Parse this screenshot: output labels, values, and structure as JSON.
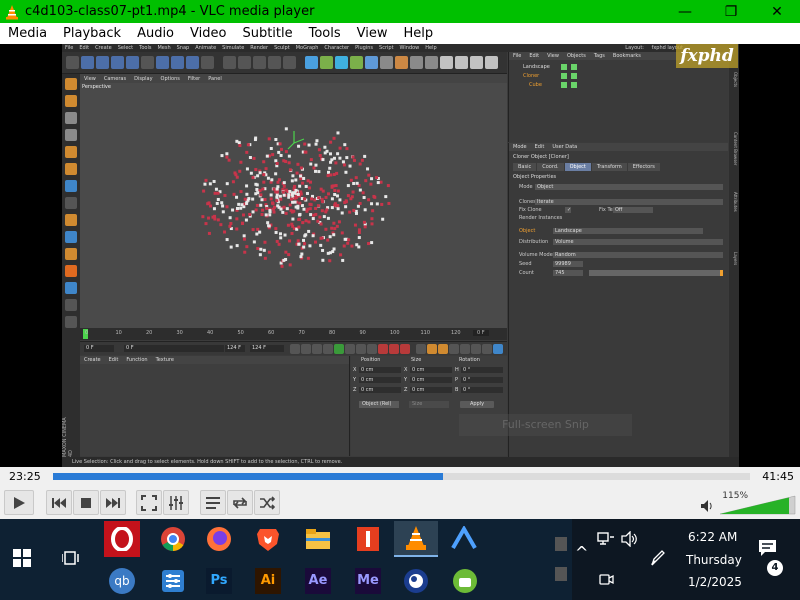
{
  "window": {
    "title": "c4d103-class07-pt1.mp4 - VLC media player",
    "minimize": "—",
    "maximize": "❐",
    "close": "✕"
  },
  "menu": [
    "Media",
    "Playback",
    "Audio",
    "Video",
    "Subtitle",
    "Tools",
    "View",
    "Help"
  ],
  "c4d": {
    "menu": [
      "File",
      "Edit",
      "Create",
      "Select",
      "Tools",
      "Mesh",
      "Snap",
      "Animate",
      "Simulate",
      "Render",
      "Sculpt",
      "MoGraph",
      "Character",
      "Plugins",
      "Script",
      "Window",
      "Help"
    ],
    "layout_label": "Layout:",
    "layout_value": "fxphd layout",
    "viewport_menu": [
      "View",
      "Cameras",
      "Display",
      "Options",
      "Filter",
      "Panel"
    ],
    "viewport_name": "Perspective",
    "timeline_ticks": [
      "0",
      "10",
      "20",
      "30",
      "40",
      "50",
      "60",
      "70",
      "80",
      "90",
      "100",
      "110",
      "120"
    ],
    "frame_readout": "0 F",
    "transport": {
      "start": "0 F",
      "current": "0 F",
      "end": "124 F",
      "end2": "124 F"
    },
    "materials_menu": [
      "Create",
      "Edit",
      "Function",
      "Texture"
    ],
    "coords_headers": [
      "Position",
      "Size",
      "Rotation"
    ],
    "coords": [
      {
        "axis": "X",
        "pos": "0 cm",
        "size_axis": "X",
        "size": "0 cm",
        "rot_axis": "H",
        "rot": "0 °"
      },
      {
        "axis": "Y",
        "pos": "0 cm",
        "size_axis": "Y",
        "size": "0 cm",
        "rot_axis": "P",
        "rot": "0 °"
      },
      {
        "axis": "Z",
        "pos": "0 cm",
        "size_axis": "Z",
        "size": "0 cm",
        "rot_axis": "B",
        "rot": "0 °"
      }
    ],
    "object_rel": "Object (Rel)",
    "size_mode": "Size",
    "apply": "Apply",
    "maxon": "MAXON CINEMA 4D",
    "status": "Live Selection: Click and drag to select elements. Hold down SHIFT to add to the selection, CTRL to remove.",
    "om_menu": [
      "File",
      "Edit",
      "View",
      "Objects",
      "Tags",
      "Bookmarks"
    ],
    "om_objects": [
      {
        "name": "Landscape",
        "color": "#dddddd"
      },
      {
        "name": "Cloner",
        "color": "#f0a030"
      },
      {
        "name": "Cube",
        "color": "#f0a030"
      }
    ],
    "attr_menu": [
      "Mode",
      "Edit",
      "User Data"
    ],
    "attr_title": "Cloner Object [Cloner]",
    "attr_tabs": [
      "Basic",
      "Coord.",
      "Object",
      "Transform",
      "Effectors"
    ],
    "attr_active_tab": "Object",
    "attr_section": "Object Properties",
    "attrs": [
      {
        "label": "Mode",
        "value": "Object"
      },
      {
        "label": "Clones",
        "value": "Iterate"
      },
      {
        "label": "Fix Clone",
        "value": "✓"
      },
      {
        "label": "Fix Texture",
        "value": "Off"
      },
      {
        "label": "Render Instances",
        "value": ""
      },
      {
        "label": "Object",
        "value": "Landscape"
      },
      {
        "label": "Distribution",
        "value": "Volume"
      },
      {
        "label": "Volume Mode",
        "value": "Random"
      },
      {
        "label": "Seed",
        "value": "99989"
      },
      {
        "label": "Count",
        "value": "745"
      }
    ],
    "side_tabs": [
      "Objects",
      "Content Browser",
      "Attributes",
      "Layers"
    ],
    "logo": "fxphd"
  },
  "snip_overlay": "Full-screen Snip",
  "playback": {
    "current_time": "23:25",
    "total_time": "41:45",
    "progress": 0.56,
    "volume_pct": "115%",
    "volume": 1.15
  },
  "taskbar": {
    "time": "6:22 AM",
    "day": "Thursday",
    "date": "1/2/2025",
    "notifications": "4",
    "apps_top": [
      "opera-icon",
      "chrome-icon",
      "firefox-icon",
      "brave-icon",
      "file-explorer-icon",
      "pdf-icon",
      "vlc-icon",
      "vpn-icon"
    ],
    "apps_bottom": [
      "qbittorrent-icon",
      "settings-icon",
      "photoshop-icon",
      "illustrator-icon",
      "after-effects-icon",
      "media-encoder-icon",
      "cinema4d-icon",
      "android-icon"
    ],
    "labels_bottom": {
      "qb": "qb",
      "ps": "Ps",
      "ai": "Ai",
      "ae": "Ae",
      "me": "Me"
    }
  },
  "colors": {
    "vlc_green": "#00c000",
    "seek_fill": "#2a7bd6",
    "taskbar": "#0e2133"
  }
}
